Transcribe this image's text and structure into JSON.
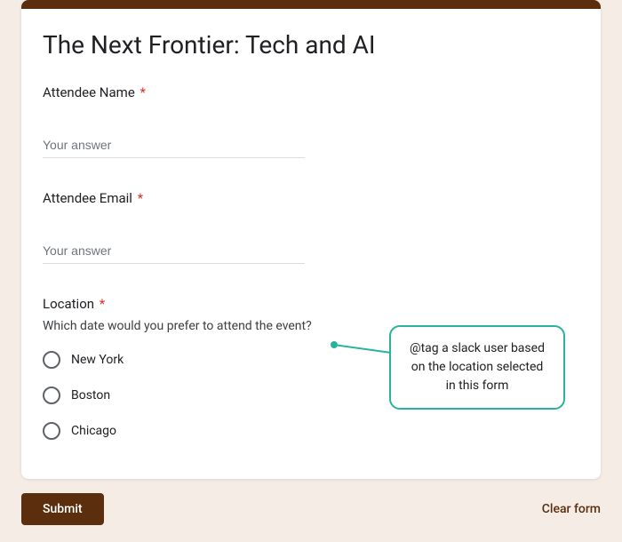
{
  "form": {
    "title": "The Next Frontier: Tech and AI",
    "fields": {
      "name": {
        "label": "Attendee Name",
        "required": "*",
        "placeholder": "Your answer"
      },
      "email": {
        "label": "Attendee Email",
        "required": "*",
        "placeholder": "Your answer"
      },
      "location": {
        "label": "Location",
        "required": "*",
        "description": "Which date would you prefer to attend the event?",
        "options": [
          "New York",
          "Boston",
          "Chicago"
        ]
      }
    },
    "submit_label": "Submit",
    "clear_label": "Clear form"
  },
  "tooltip": {
    "text": "@tag a slack user based on the location selected in this form"
  }
}
